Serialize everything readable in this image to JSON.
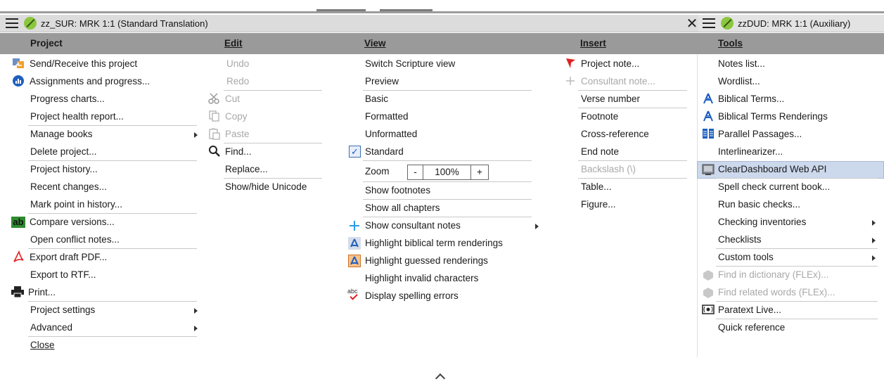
{
  "left_pane": {
    "title": "zz_SUR: MRK 1:1 (Standard Translation)",
    "close_glyph": "✕"
  },
  "right_pane": {
    "title": "zzDUD: MRK 1:1 (Auxiliary)"
  },
  "menubar": {
    "project": "Project",
    "edit": "Edit",
    "view": "View",
    "insert": "Insert",
    "tools": "Tools"
  },
  "project_menu": [
    "Send/Receive this project",
    "Assignments and progress...",
    "Progress charts...",
    "Project health report...",
    "Manage books",
    "Delete project...",
    "Project history...",
    "Recent changes...",
    "Mark point in history...",
    "Compare versions...",
    "Open conflict notes...",
    "Export draft PDF...",
    "Export to RTF...",
    "Print...",
    "Project settings",
    "Advanced",
    "Close"
  ],
  "edit_menu": [
    "Undo",
    "Redo",
    "Cut",
    "Copy",
    "Paste",
    "Find...",
    "Replace...",
    "Show/hide Unicode"
  ],
  "view_menu": {
    "items": [
      "Switch Scripture view",
      "Preview",
      "Basic",
      "Formatted",
      "Unformatted",
      "Standard"
    ],
    "zoom_label": "Zoom",
    "zoom_minus": "-",
    "zoom_value": "100%",
    "zoom_plus": "+",
    "items2": [
      "Show footnotes",
      "Show all chapters",
      "Show consultant notes",
      "Highlight biblical term renderings",
      "Highlight guessed renderings",
      "Highlight invalid characters",
      "Display spelling errors"
    ]
  },
  "insert_menu": [
    "Project note...",
    "Consultant note...",
    "Verse number",
    "Footnote",
    "Cross-reference",
    "End note",
    "Backslash (\\)",
    "Table...",
    "Figure..."
  ],
  "tools_menu": [
    "Notes list...",
    "Wordlist...",
    "Biblical Terms...",
    "Biblical Terms Renderings",
    "Parallel Passages...",
    "Interlinearizer...",
    "ClearDashboard Web API",
    "Spell check current book...",
    "Run basic checks...",
    "Checking inventories",
    "Checklists",
    "Custom tools",
    "Find in dictionary (FLEx)...",
    "Find related words (FLEx)...",
    "Paratext Live...",
    "Quick reference"
  ],
  "icons": {
    "abc": "abc",
    "ab": "ab"
  },
  "colors": {
    "menubar": "#9a9a9a",
    "highlight": "#ccd8ec",
    "disabled": "#a8a8a8",
    "accent_red": "#e02020",
    "accent_blue": "#1d5fbf"
  }
}
